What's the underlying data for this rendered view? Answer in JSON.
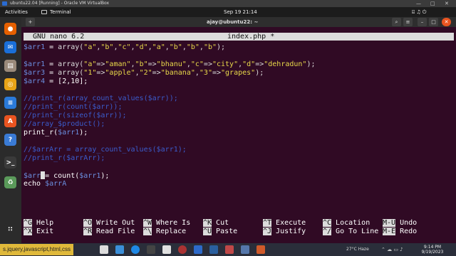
{
  "vbox": {
    "title": "ubuntu22.04 [Running] - Oracle VM VirtualBox",
    "controls": [
      "—",
      "□",
      "✕"
    ]
  },
  "topbar": {
    "activities": "Activities",
    "app": "Terminal",
    "clock": "Sep 19  21:14",
    "tray": "⍇ ♫ ⏻"
  },
  "terminal": {
    "title": "ajay@ubuntu22: ~",
    "buttons": {
      "search": "⌕",
      "menu": "≡",
      "minimize": "–",
      "maximize": "□",
      "close": "✕"
    }
  },
  "nano": {
    "version": "GNU nano 6.2",
    "filename": "index.php *"
  },
  "code": [
    {
      "segments": [
        [
          "v",
          "$arr1"
        ],
        [
          "n",
          " = "
        ],
        [
          "k",
          "array("
        ],
        [
          "s",
          "\"a\""
        ],
        [
          "k",
          ","
        ],
        [
          "s",
          "\"b\""
        ],
        [
          "k",
          ","
        ],
        [
          "s",
          "\"c\""
        ],
        [
          "k",
          ","
        ],
        [
          "s",
          "\"d\""
        ],
        [
          "k",
          ","
        ],
        [
          "s",
          "\"a\""
        ],
        [
          "k",
          ","
        ],
        [
          "s",
          "\"b\""
        ],
        [
          "k",
          ","
        ],
        [
          "s",
          "\"b\""
        ],
        [
          "k",
          ","
        ],
        [
          "s",
          "\"b\""
        ],
        [
          "k",
          ");"
        ]
      ]
    },
    {
      "segments": []
    },
    {
      "segments": [
        [
          "v",
          "$arr1"
        ],
        [
          "n",
          " = "
        ],
        [
          "k",
          "array("
        ],
        [
          "s",
          "\"a\""
        ],
        [
          "k",
          "=>"
        ],
        [
          "s",
          "\"aman\""
        ],
        [
          "k",
          ","
        ],
        [
          "s",
          "\"b\""
        ],
        [
          "k",
          "=>"
        ],
        [
          "s",
          "\"bhanu\""
        ],
        [
          "k",
          ","
        ],
        [
          "s",
          "\"c\""
        ],
        [
          "k",
          "=>"
        ],
        [
          "s",
          "\"city\""
        ],
        [
          "k",
          ","
        ],
        [
          "s",
          "\"d\""
        ],
        [
          "k",
          "=>"
        ],
        [
          "s",
          "\"dehradun\""
        ],
        [
          "k",
          ");"
        ]
      ]
    },
    {
      "segments": [
        [
          "v",
          "$arr3"
        ],
        [
          "n",
          " = "
        ],
        [
          "k",
          "array("
        ],
        [
          "s",
          "\"1\""
        ],
        [
          "k",
          "=>"
        ],
        [
          "s",
          "\"apple\""
        ],
        [
          "k",
          ","
        ],
        [
          "s",
          "\"2\""
        ],
        [
          "k",
          "=>"
        ],
        [
          "s",
          "\"banana\""
        ],
        [
          "k",
          ","
        ],
        [
          "s",
          "\"3\""
        ],
        [
          "k",
          "=>"
        ],
        [
          "s",
          "\"grapes\""
        ],
        [
          "k",
          ");"
        ]
      ]
    },
    {
      "segments": [
        [
          "v",
          "$arr4"
        ],
        [
          "n",
          " = [2,10];"
        ]
      ]
    },
    {
      "segments": []
    },
    {
      "segments": [
        [
          "c",
          "//print_r(array_count_values($arr));"
        ]
      ]
    },
    {
      "segments": [
        [
          "c",
          "//print_r(count($arr));"
        ]
      ]
    },
    {
      "segments": [
        [
          "c",
          "//print_r(sizeof($arr));"
        ]
      ]
    },
    {
      "segments": [
        [
          "c",
          "//array_$product();"
        ]
      ]
    },
    {
      "segments": [
        [
          "n",
          "print_r("
        ],
        [
          "v",
          "$arr1"
        ],
        [
          "n",
          ");"
        ]
      ]
    },
    {
      "segments": []
    },
    {
      "segments": [
        [
          "c",
          "//$arrArr = array_count_values($arr1);"
        ]
      ]
    },
    {
      "segments": [
        [
          "c",
          "//print_r($arrArr);"
        ]
      ]
    },
    {
      "segments": []
    },
    {
      "segments": [
        [
          "v",
          "$arr"
        ],
        [
          "cur",
          ""
        ],
        [
          "n",
          "= count("
        ],
        [
          "v",
          "$arr1"
        ],
        [
          "n",
          ");"
        ]
      ]
    },
    {
      "segments": [
        [
          "n",
          "echo "
        ],
        [
          "v",
          "$arrA"
        ]
      ]
    }
  ],
  "shortcuts": [
    {
      "key": "^G",
      "label": "Help"
    },
    {
      "key": "^O",
      "label": "Write Out"
    },
    {
      "key": "^W",
      "label": "Where Is"
    },
    {
      "key": "^K",
      "label": "Cut"
    },
    {
      "key": "^T",
      "label": "Execute"
    },
    {
      "key": "^C",
      "label": "Location"
    },
    {
      "key": "M-U",
      "label": "Undo"
    },
    {
      "key": "^X",
      "label": "Exit"
    },
    {
      "key": "^R",
      "label": "Read File"
    },
    {
      "key": "^\\",
      "label": "Replace"
    },
    {
      "key": "^U",
      "label": "Paste"
    },
    {
      "key": "^J",
      "label": "Justify"
    },
    {
      "key": "^/",
      "label": "Go To Line"
    },
    {
      "key": "M-E",
      "label": "Redo"
    }
  ],
  "dock_icons": [
    {
      "name": "firefox-icon",
      "color": "#e66000",
      "glyph": "●"
    },
    {
      "name": "thunderbird-icon",
      "color": "#1a6fd8",
      "glyph": "✉"
    },
    {
      "name": "files-icon",
      "color": "#9a8a7a",
      "glyph": "▤"
    },
    {
      "name": "rhythmbox-icon",
      "color": "#e8a317",
      "glyph": "◎"
    },
    {
      "name": "libreoffice-writer-icon",
      "color": "#2a7ad8",
      "glyph": "≡"
    },
    {
      "name": "app-center-icon",
      "color": "#e95420",
      "glyph": "A"
    },
    {
      "name": "help-icon",
      "color": "#3a7bd5",
      "glyph": "?"
    },
    {
      "name": "terminal-icon",
      "color": "#3a3a3a",
      "glyph": ">_"
    },
    {
      "name": "trash-icon",
      "color": "#5a9a5a",
      "glyph": "♻"
    },
    {
      "name": "show-apps-icon",
      "color": "#2b2b2b",
      "glyph": "∷"
    }
  ],
  "taskbar": {
    "search": "s.jquery,javascript,html,css",
    "weather": "27°C Haze",
    "tray": "⌃ ☁ ▭ ♪",
    "time": "9:14 PM",
    "date": "9/19/2023"
  }
}
